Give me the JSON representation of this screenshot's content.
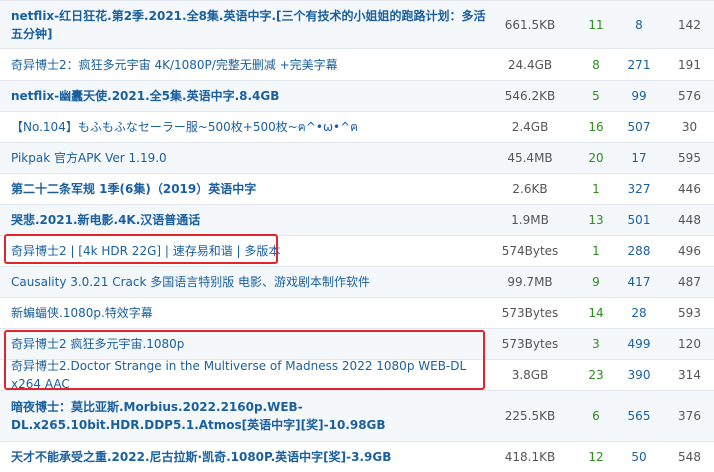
{
  "rows": [
    {
      "name": "netflix-红日狂花.第2季.2021.全8集.英语中字.[三个有技术的小姐姐的跑路计划：多活五分钟]",
      "size": "661.5KB",
      "seeders": "11",
      "leechers": "8",
      "completed": "142",
      "bold": true
    },
    {
      "name": "奇异博士2：疯狂多元宇宙 4K/1080P/完整无删减 +完美字幕",
      "size": "24.4GB",
      "seeders": "8",
      "leechers": "271",
      "completed": "191",
      "bold": false
    },
    {
      "name": "netflix-幽蠹天使.2021.全5集.英语中字.8.4GB",
      "size": "546.2KB",
      "seeders": "5",
      "leechers": "99",
      "completed": "576",
      "bold": true
    },
    {
      "name": "【No.104】もふもふなセーラー服~500枚+500枚~ฅ^•ω•^ฅ",
      "size": "2.4GB",
      "seeders": "16",
      "leechers": "507",
      "completed": "30",
      "bold": false
    },
    {
      "name": "Pikpak 官方APK Ver 1.19.0",
      "size": "45.4MB",
      "seeders": "20",
      "leechers": "17",
      "completed": "595",
      "bold": false
    },
    {
      "name": "第二十二条军规 1季(6集)（2019）英语中字",
      "size": "2.6KB",
      "seeders": "1",
      "leechers": "327",
      "completed": "446",
      "bold": true
    },
    {
      "name": "哭悲.2021.新电影.4K.汉语普通话",
      "size": "1.9MB",
      "seeders": "13",
      "leechers": "501",
      "completed": "448",
      "bold": true
    },
    {
      "name": "奇异博士2 | [4k HDR 22G] | 速存易和谐 | 多版本",
      "size": "574Bytes",
      "seeders": "1",
      "leechers": "288",
      "completed": "496",
      "bold": false
    },
    {
      "name": "Causality 3.0.21 Crack 多国语言特别版 电影、游戏剧本制作软件",
      "size": "99.7MB",
      "seeders": "9",
      "leechers": "417",
      "completed": "487",
      "bold": false
    },
    {
      "name": "新蝙蝠侠.1080p.特效字幕",
      "size": "573Bytes",
      "seeders": "14",
      "leechers": "28",
      "completed": "593",
      "bold": false
    },
    {
      "name": "奇异博士2 疯狂多元宇宙.1080p",
      "size": "573Bytes",
      "seeders": "3",
      "leechers": "499",
      "completed": "120",
      "bold": false
    },
    {
      "name": "奇异博士2.Doctor Strange in the Multiverse of Madness 2022 1080p WEB-DL x264 AAC",
      "size": "3.8GB",
      "seeders": "23",
      "leechers": "390",
      "completed": "314",
      "bold": false
    },
    {
      "name": "暗夜博士：莫比亚斯.Morbius.2022.2160p.WEB-DL.x265.10bit.HDR.DDP5.1.Atmos[英语中字][奖]-10.98GB",
      "size": "225.5KB",
      "seeders": "6",
      "leechers": "565",
      "completed": "376",
      "bold": true
    },
    {
      "name": "天才不能承受之重.2022.尼古拉斯·凯奇.1080P.英语中字[奖]-3.9GB",
      "size": "418.1KB",
      "seeders": "12",
      "leechers": "50",
      "completed": "548",
      "bold": true
    }
  ],
  "highlight_color": "#e0262a",
  "seeders_color": "#2e8b1e",
  "link_color": "#1a5f9e"
}
